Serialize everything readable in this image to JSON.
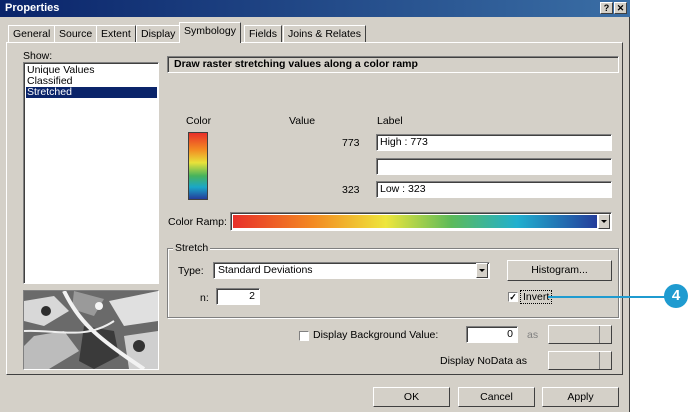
{
  "window": {
    "title": "Properties",
    "help_btn": "?",
    "close_btn": "✕"
  },
  "tabs": [
    {
      "label": "General"
    },
    {
      "label": "Source"
    },
    {
      "label": "Extent"
    },
    {
      "label": "Display"
    },
    {
      "label": "Symbology"
    },
    {
      "label": "Fields"
    },
    {
      "label": "Joins & Relates"
    }
  ],
  "show": {
    "label": "Show:",
    "items": [
      {
        "label": "Unique Values"
      },
      {
        "label": "Classified"
      },
      {
        "label": "Stretched"
      }
    ],
    "selected": "Stretched"
  },
  "panel": {
    "header": "Draw raster stretching values along a color ramp",
    "col_color": "Color",
    "col_value": "Value",
    "col_label": "Label",
    "rows": [
      {
        "value": "773",
        "label": "High : 773"
      },
      {
        "value": "",
        "label": ""
      },
      {
        "value": "323",
        "label": "Low : 323"
      }
    ],
    "color_ramp_label": "Color Ramp:"
  },
  "stretch": {
    "group_label": "Stretch",
    "type_label": "Type:",
    "type_value": "Standard Deviations",
    "histogram_btn": "Histogram...",
    "n_label": "n:",
    "n_value": "2",
    "invert_label": "Invert",
    "invert_checked": "✓"
  },
  "background": {
    "label": "Display Background Value:",
    "value": "0",
    "as_label": "as",
    "nodata_label": "Display NoData as"
  },
  "buttons": {
    "ok": "OK",
    "cancel": "Cancel",
    "apply": "Apply"
  },
  "callout": {
    "number": "4",
    "color": "#1f9bd0"
  }
}
